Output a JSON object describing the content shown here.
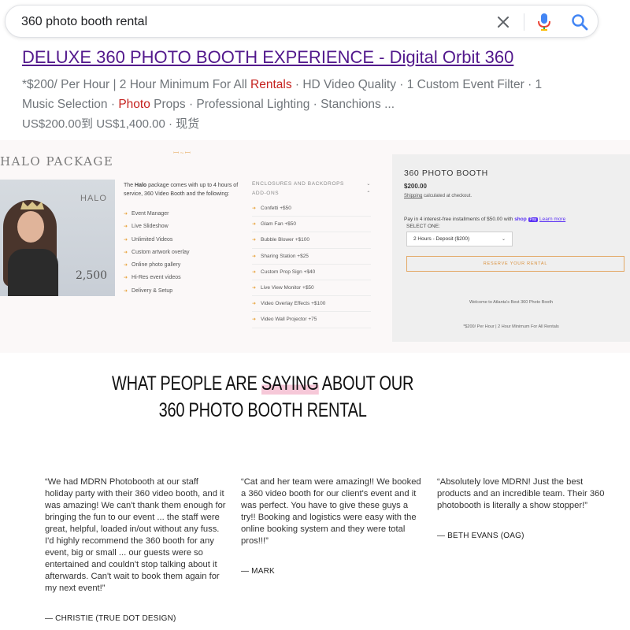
{
  "search": {
    "query": "360 photo booth rental"
  },
  "result": {
    "title": "DELUXE 360 PHOTO BOOTH EXPERIENCE - Digital Orbit 360",
    "snippet_a": "*$200/ Per Hour | 2 Hour Minimum For All ",
    "snippet_hl1": "Rentals",
    "snippet_b": " · HD Video Quality · 1 Custom Event Filter · 1 Music Selection · ",
    "snippet_hl2": "Photo",
    "snippet_c": " Props · Professional Lighting · Stanchions ...",
    "price_line": "US$200.00到 US$1,400.00 · 现货"
  },
  "site": {
    "package_heading": "HALO PACKAGE",
    "photo_label": "HALO",
    "photo_count": "2,500",
    "desc_a": "The ",
    "desc_bold": "Halo",
    "desc_b": " package comes with up to 4 hours of service, 360 Video Booth and the following:",
    "features": [
      "Event Manager",
      "Live Slideshow",
      "Unlimited Videos",
      "Custom artwork overlay",
      "Online photo gallery",
      "Hi-Res event videos",
      "Delivery & Setup"
    ],
    "enclosures_label": "ENCLOSURES AND BACKDROPS",
    "addons_label": "ADD-ONS",
    "addons": [
      "Confetti +$50",
      "Glam Fan +$50",
      "Bubble Blower +$100",
      "Sharing Station +$25",
      "Custom Prop Sign +$40",
      "Live View Monitor +$50",
      "Video Overlay Effects +$100",
      "Video Wall Projector +75"
    ],
    "shop": {
      "title": "360 PHOTO BOOTH",
      "price": "$200.00",
      "shipping_link": "Shipping",
      "shipping_text": " calculated at checkout.",
      "pay_text": "Pay in 4 interest-free installments of $50.00 with ",
      "pay_brand": "shop",
      "pay_badge": "Pay",
      "learn_more": "Learn more",
      "select_label": "SELECT ONE:",
      "select_value": "2 Hours - Deposit ($200)",
      "reserve_button": "RESERVE YOUR RENTAL",
      "welcome": "Welcome to Atlanta's Best 360 Photo Booth",
      "footer_note": "*$200/ Per Hour | 2 Hour Minimum For All Rentals"
    }
  },
  "testimonials": {
    "heading_a": "WHAT PEOPLE ARE ",
    "heading_hl": "SAYING",
    "heading_b": " ABOUT OUR",
    "heading_line2": "360 PHOTO BOOTH RENTAL",
    "items": [
      {
        "quote": "“We had MDRN Photobooth at our staff holiday party with their 360 video booth, and it was amazing! We can't thank them enough for bringing the fun to our event ... the staff were great, helpful, loaded in/out without any fuss. I'd highly recommend the 360 booth for any event, big or small ... our guests were so entertained and couldn't stop talking about it afterwards. Can't wait to book them again for my next event!”",
        "author": "— CHRISTIE (TRUE DOT DESIGN)"
      },
      {
        "quote": "“Cat and her team were amazing!! We booked a 360 video booth for our client's event and it was perfect. You have to give these guys a try!! Booking and logistics were easy with the online booking system and they were total pros!!!”",
        "author": "— MARK"
      },
      {
        "quote": "“Absolutely love MDRN! Just the best products and an incredible team. Their 360 photobooth is literally a show stopper!”",
        "author": "— BETH EVANS (OAG)"
      }
    ]
  },
  "colors": {
    "visited_link": "#52188c",
    "keyword_red": "#c5221f",
    "accent_orange": "#e8a33c",
    "highlight_pink": "#f6c8d8",
    "mic_blue": "#4285f4",
    "mic_red": "#ea4335"
  },
  "icons": [
    "clear-icon",
    "mic-icon",
    "search-icon",
    "chevron-down-icon",
    "bullet-arrow-icon"
  ]
}
